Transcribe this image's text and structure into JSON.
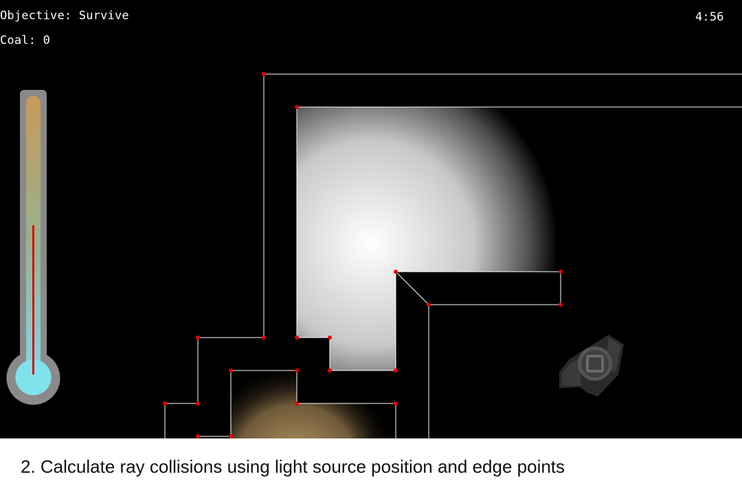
{
  "hud": {
    "objective": "Objective: Survive",
    "coal": "Coal: 0",
    "timer": "4:56"
  },
  "thermometer": {
    "level": 0.4,
    "fluid_color": "#e00000",
    "bulb_color": "#7fe3ee"
  },
  "scene": {
    "wall_outline_color": "#ffffff",
    "edge_point_color": "#e80000",
    "light_color": "#ffffff",
    "warm_light_color": "#c8a46a"
  },
  "caption": {
    "text": "2. Calculate ray collisions using light source position and edge points"
  }
}
